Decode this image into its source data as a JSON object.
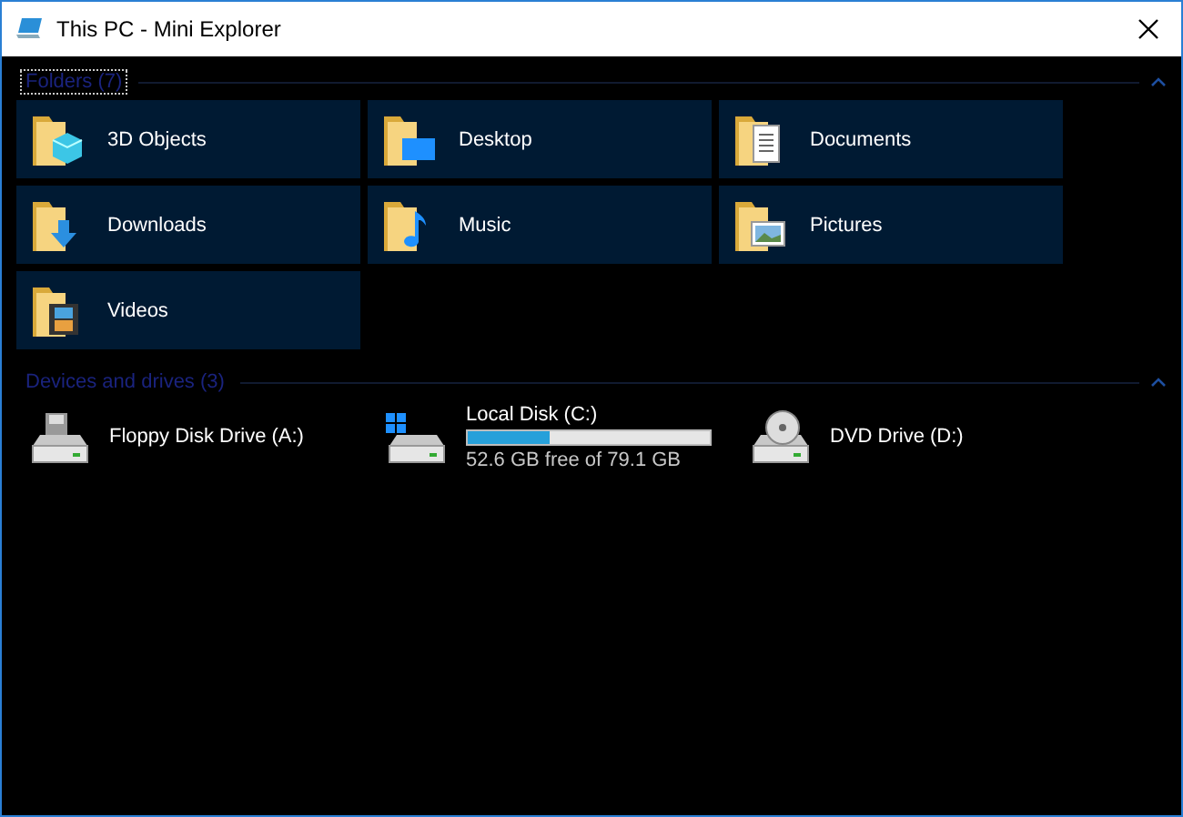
{
  "window": {
    "title": "This PC - Mini Explorer"
  },
  "sections": [
    {
      "title": "Folders (7)",
      "focused": true,
      "expanded": true,
      "kind": "folders",
      "items": [
        {
          "kind": "objects",
          "label": "3D Objects"
        },
        {
          "kind": "desktop",
          "label": "Desktop"
        },
        {
          "kind": "documents",
          "label": "Documents"
        },
        {
          "kind": "downloads",
          "label": "Downloads"
        },
        {
          "kind": "music",
          "label": "Music"
        },
        {
          "kind": "pictures",
          "label": "Pictures"
        },
        {
          "kind": "videos",
          "label": "Videos"
        }
      ]
    },
    {
      "title": "Devices and drives (3)",
      "focused": false,
      "expanded": true,
      "kind": "drives",
      "items": [
        {
          "kind": "floppy",
          "label": "Floppy Disk Drive (A:)"
        },
        {
          "kind": "local",
          "label": "Local Disk (C:)",
          "level": 0.335,
          "free": "52.6 GB free of 79.1 GB"
        },
        {
          "kind": "dvd",
          "label": "DVD Drive (D:)"
        }
      ]
    }
  ]
}
